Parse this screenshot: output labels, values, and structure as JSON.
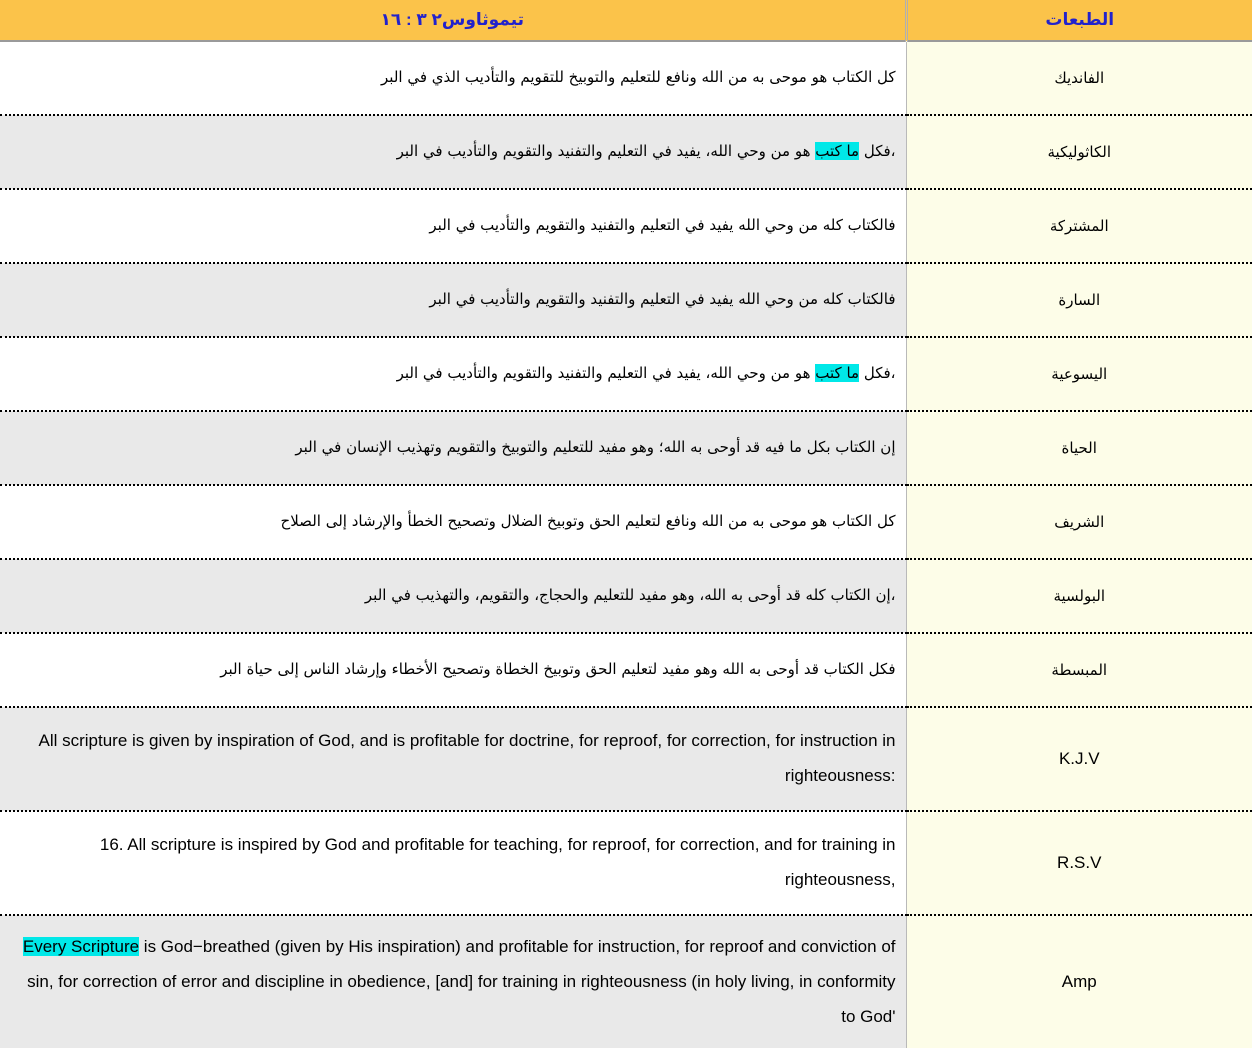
{
  "header": {
    "verse_reference": "تيموثاوس٢ ٣ : ١٦",
    "editions_label": "الطبعات",
    "bg_color": "#fbc34a",
    "text_color": "#2222cc"
  },
  "highlight_color": "#00e8e8",
  "rows": [
    {
      "edition": "الفانديك",
      "lang": "ar",
      "rowspan": 1,
      "segments": [
        {
          "text": "كل الكتاب هو موحى به من الله ونافع للتعليم والتوبيخ للتقويم والتأديب الذي في البر",
          "highlight": false
        }
      ]
    },
    {
      "edition": "الكاثوليكية",
      "lang": "ar",
      "rowspan": 1,
      "segments": [
        {
          "text": "،فكل ",
          "highlight": false
        },
        {
          "text": "ما كتب",
          "highlight": true
        },
        {
          "text": " هو من وحي الله، يفيد في التعليم والتفنيد والتقويم والتأديب في البر",
          "highlight": false
        }
      ]
    },
    {
      "edition": "المشتركة",
      "lang": "ar",
      "rowspan": 1,
      "segments": [
        {
          "text": "فالكتاب كله من وحي الله  يفيد في التعليم والتفنيد والتقويم والتأديب في البر",
          "highlight": false
        }
      ]
    },
    {
      "edition": "السارة",
      "lang": "ar",
      "rowspan": 1,
      "segments": [
        {
          "text": "فالكتاب كله من وحي الله  يفيد في التعليم والتفنيد والتقويم والتأديب في البر",
          "highlight": false
        }
      ]
    },
    {
      "edition": "اليسوعية",
      "lang": "ar",
      "rowspan": 1,
      "segments": [
        {
          "text": "،فكل ",
          "highlight": false
        },
        {
          "text": "ما كتب",
          "highlight": true
        },
        {
          "text": " هو من وحي الله، يفيد في التعليم والتفنيد والتقويم والتأديب في البر",
          "highlight": false
        }
      ]
    },
    {
      "edition": "الحياة",
      "lang": "ar",
      "rowspan": 1,
      "segments": [
        {
          "text": "إن الكتاب بكل ما فيه  قد أوحى به الله؛ وهو مفيد للتعليم والتوبيخ والتقويم وتهذيب الإنسان في البر",
          "highlight": false
        }
      ]
    },
    {
      "edition": "الشريف",
      "lang": "ar",
      "rowspan": 1,
      "segments": [
        {
          "text": "كل الكتاب هو موحى به من الله  ونافع لتعليم الحق  وتوبيخ الضلال  وتصحيح الخطأ  والإرشاد إلى الصلاح",
          "highlight": false
        }
      ]
    },
    {
      "edition": "البولسية",
      "lang": "ar",
      "rowspan": 1,
      "segments": [
        {
          "text": "،إن الكتاب كله قد أوحى به الله، وهو مفيد للتعليم والحجاج، والتقويم، والتهذيب في البر",
          "highlight": false
        }
      ]
    },
    {
      "edition": "المبسطة",
      "lang": "ar",
      "rowspan": 1,
      "segments": [
        {
          "text": "فكل الكتاب قد أوحى به الله  وهو مفيد لتعليم الحق  وتوبيخ الخطاة  وتصحيح الأخطاء  وإرشاد الناس إلى حياة البر",
          "highlight": false
        }
      ]
    },
    {
      "edition": "K.J.V",
      "lang": "en",
      "rowspan": 2,
      "segments": [
        {
          "text": "All scripture is given by inspiration of God, and is profitable for doctrine, for reproof, for correction, for instruction in righteousness:",
          "highlight": false
        }
      ]
    },
    {
      "edition": "R.S.V",
      "lang": "en",
      "rowspan": 2,
      "segments": [
        {
          "text": "16. All scripture is inspired by God and profitable for teaching, for reproof, for correction, and for training in righteousness,",
          "highlight": false
        }
      ]
    },
    {
      "edition": "Amp",
      "lang": "en",
      "rowspan": 3,
      "segments": [
        {
          "text": "Every Scripture",
          "highlight": true
        },
        {
          "text": " is God−breathed (given by His inspiration) and profitable for instruction, for reproof and conviction of sin, for correction of error and discipline in obedience, [and] for training in righteousness (in holy living, in conformity to God'",
          "highlight": false
        }
      ]
    }
  ]
}
